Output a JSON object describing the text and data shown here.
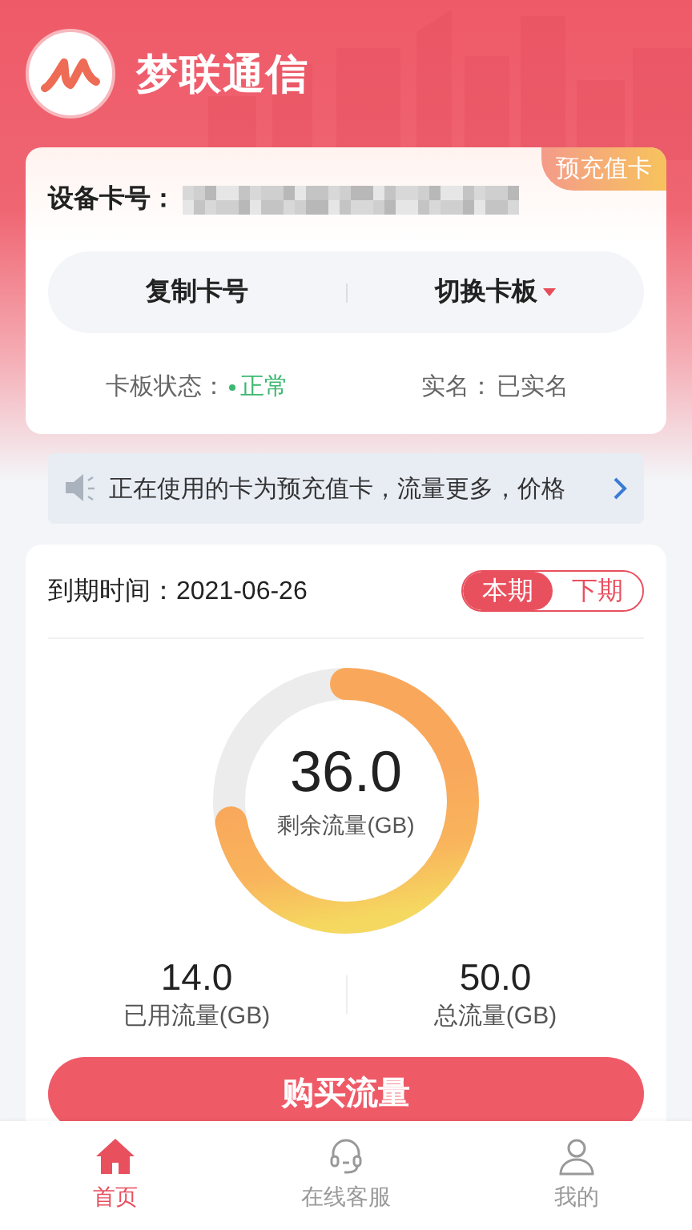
{
  "app": {
    "title": "梦联通信"
  },
  "card": {
    "badge": "预充值卡",
    "number_label": "设备卡号：",
    "actions": [
      {
        "label": "复制卡号",
        "kind": "plain"
      },
      {
        "label": "切换卡板",
        "kind": "dropdown"
      }
    ],
    "status_label": "卡板状态：",
    "status": "正常",
    "realname_label": "实名：",
    "realname": "已实名"
  },
  "notice": {
    "text": "正在使用的卡为预充值卡，流量更多，价格"
  },
  "usage": {
    "expiry_label": "到期时间：",
    "expiry": "2021-06-26",
    "periods": [
      {
        "label": "本期",
        "selected": true
      },
      {
        "label": "下期",
        "selected": false
      }
    ],
    "remaining": "36.0",
    "remaining_label": "剩余流量(GB)",
    "level": 0.72,
    "stats": [
      {
        "value": "14.0",
        "label": "已用流量(GB)"
      },
      {
        "value": "50.0",
        "label": "总流量(GB)"
      }
    ],
    "buy_button": "购买流量"
  },
  "tabs": [
    {
      "label": "首页",
      "kind": "home",
      "selected": true
    },
    {
      "label": "在线客服",
      "kind": "service",
      "selected": false
    },
    {
      "label": "我的",
      "kind": "profile",
      "selected": false
    }
  ]
}
